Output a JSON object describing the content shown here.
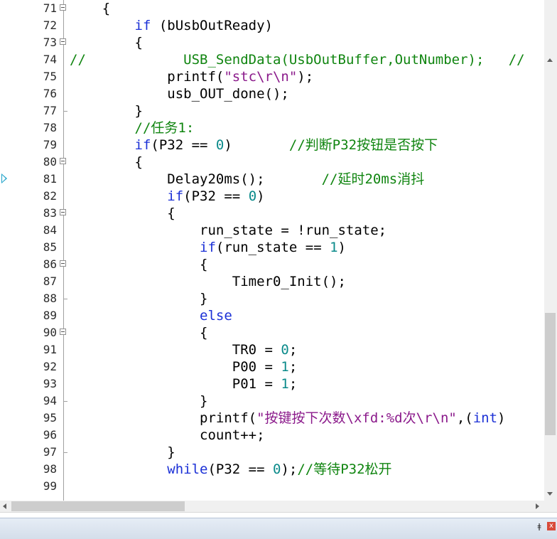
{
  "editor": {
    "lines": [
      {
        "n": "71",
        "fold": "open",
        "parts": [
          {
            "t": "    {",
            "c": ""
          }
        ]
      },
      {
        "n": "72",
        "fold": "",
        "parts": [
          {
            "t": "        ",
            "c": ""
          },
          {
            "t": "if",
            "c": "kw"
          },
          {
            "t": " (bUsbOutReady)",
            "c": ""
          }
        ]
      },
      {
        "n": "73",
        "fold": "open",
        "parts": [
          {
            "t": "        {",
            "c": ""
          }
        ]
      },
      {
        "n": "74",
        "fold": "",
        "parts": [
          {
            "t": "//",
            "c": "com"
          },
          {
            "t": "            USB_SendData(UsbOutBuffer,OutNumber);   //",
            "c": "com"
          }
        ]
      },
      {
        "n": "75",
        "fold": "",
        "parts": [
          {
            "t": "            printf(",
            "c": ""
          },
          {
            "t": "\"stc\\r\\n\"",
            "c": "str"
          },
          {
            "t": ");",
            "c": ""
          }
        ]
      },
      {
        "n": "76",
        "fold": "",
        "parts": [
          {
            "t": "            usb_OUT_done();",
            "c": ""
          }
        ]
      },
      {
        "n": "77",
        "fold": "end",
        "parts": [
          {
            "t": "        }",
            "c": ""
          }
        ]
      },
      {
        "n": "78",
        "fold": "",
        "parts": [
          {
            "t": "        ",
            "c": ""
          },
          {
            "t": "//任务1:",
            "c": "com"
          }
        ]
      },
      {
        "n": "79",
        "fold": "",
        "parts": [
          {
            "t": "        ",
            "c": ""
          },
          {
            "t": "if",
            "c": "kw"
          },
          {
            "t": "(P32 == ",
            "c": ""
          },
          {
            "t": "0",
            "c": "num"
          },
          {
            "t": ")       ",
            "c": ""
          },
          {
            "t": "//判断P32按钮是否按下",
            "c": "com"
          }
        ]
      },
      {
        "n": "80",
        "fold": "open",
        "parts": [
          {
            "t": "        {",
            "c": ""
          }
        ]
      },
      {
        "n": "81",
        "fold": "",
        "parts": [
          {
            "t": "            Delay20ms();       ",
            "c": ""
          },
          {
            "t": "//延时20ms消抖",
            "c": "com"
          }
        ]
      },
      {
        "n": "82",
        "fold": "",
        "parts": [
          {
            "t": "            ",
            "c": ""
          },
          {
            "t": "if",
            "c": "kw"
          },
          {
            "t": "(P32 == ",
            "c": ""
          },
          {
            "t": "0",
            "c": "num"
          },
          {
            "t": ")",
            "c": ""
          }
        ]
      },
      {
        "n": "83",
        "fold": "open",
        "parts": [
          {
            "t": "            {",
            "c": ""
          }
        ]
      },
      {
        "n": "84",
        "fold": "",
        "parts": [
          {
            "t": "                run_state = !run_state;",
            "c": ""
          }
        ]
      },
      {
        "n": "85",
        "fold": "",
        "parts": [
          {
            "t": "                ",
            "c": ""
          },
          {
            "t": "if",
            "c": "kw"
          },
          {
            "t": "(run_state == ",
            "c": ""
          },
          {
            "t": "1",
            "c": "num"
          },
          {
            "t": ")",
            "c": ""
          }
        ]
      },
      {
        "n": "86",
        "fold": "open",
        "parts": [
          {
            "t": "                {",
            "c": ""
          }
        ]
      },
      {
        "n": "87",
        "fold": "",
        "parts": [
          {
            "t": "                    Timer0_Init();",
            "c": ""
          }
        ]
      },
      {
        "n": "88",
        "fold": "end",
        "parts": [
          {
            "t": "                }",
            "c": ""
          }
        ]
      },
      {
        "n": "89",
        "fold": "",
        "parts": [
          {
            "t": "                ",
            "c": ""
          },
          {
            "t": "else",
            "c": "kw"
          }
        ]
      },
      {
        "n": "90",
        "fold": "open",
        "parts": [
          {
            "t": "                {",
            "c": ""
          }
        ]
      },
      {
        "n": "91",
        "fold": "",
        "parts": [
          {
            "t": "                    TR0 = ",
            "c": ""
          },
          {
            "t": "0",
            "c": "num"
          },
          {
            "t": ";",
            "c": ""
          }
        ]
      },
      {
        "n": "92",
        "fold": "",
        "parts": [
          {
            "t": "                    P00 = ",
            "c": ""
          },
          {
            "t": "1",
            "c": "num"
          },
          {
            "t": ";",
            "c": ""
          }
        ]
      },
      {
        "n": "93",
        "fold": "",
        "parts": [
          {
            "t": "                    P01 = ",
            "c": ""
          },
          {
            "t": "1",
            "c": "num"
          },
          {
            "t": ";",
            "c": ""
          }
        ]
      },
      {
        "n": "94",
        "fold": "end",
        "parts": [
          {
            "t": "                }",
            "c": ""
          }
        ]
      },
      {
        "n": "95",
        "fold": "",
        "parts": [
          {
            "t": "                printf(",
            "c": ""
          },
          {
            "t": "\"按键按下次数\\xfd:%d次\\r\\n\"",
            "c": "str"
          },
          {
            "t": ",(",
            "c": ""
          },
          {
            "t": "int",
            "c": "kw"
          },
          {
            "t": ")",
            "c": ""
          }
        ]
      },
      {
        "n": "96",
        "fold": "",
        "parts": [
          {
            "t": "                count++;",
            "c": ""
          }
        ]
      },
      {
        "n": "97",
        "fold": "end",
        "parts": [
          {
            "t": "            }",
            "c": ""
          }
        ]
      },
      {
        "n": "98",
        "fold": "",
        "parts": [
          {
            "t": "            ",
            "c": ""
          },
          {
            "t": "while",
            "c": "kw"
          },
          {
            "t": "(P32 == ",
            "c": ""
          },
          {
            "t": "0",
            "c": "num"
          },
          {
            "t": ");",
            "c": ""
          },
          {
            "t": "//等待P32松开",
            "c": "com"
          }
        ]
      },
      {
        "n": "99",
        "fold": "",
        "parts": []
      }
    ],
    "current_line_marker": "81"
  },
  "icons": {
    "fold": "fold-minus-icon",
    "marker": "current-line-arrow-icon",
    "pin": "pin-icon",
    "close": "close-icon"
  },
  "panel": {
    "pin_glyph": "ǂ",
    "close_glyph": "x"
  },
  "colors": {
    "keyword": "#1b30d6",
    "number": "#0a8a8a",
    "string": "#8b1a8b",
    "comment": "#108510",
    "close_button": "#d84a3a"
  }
}
